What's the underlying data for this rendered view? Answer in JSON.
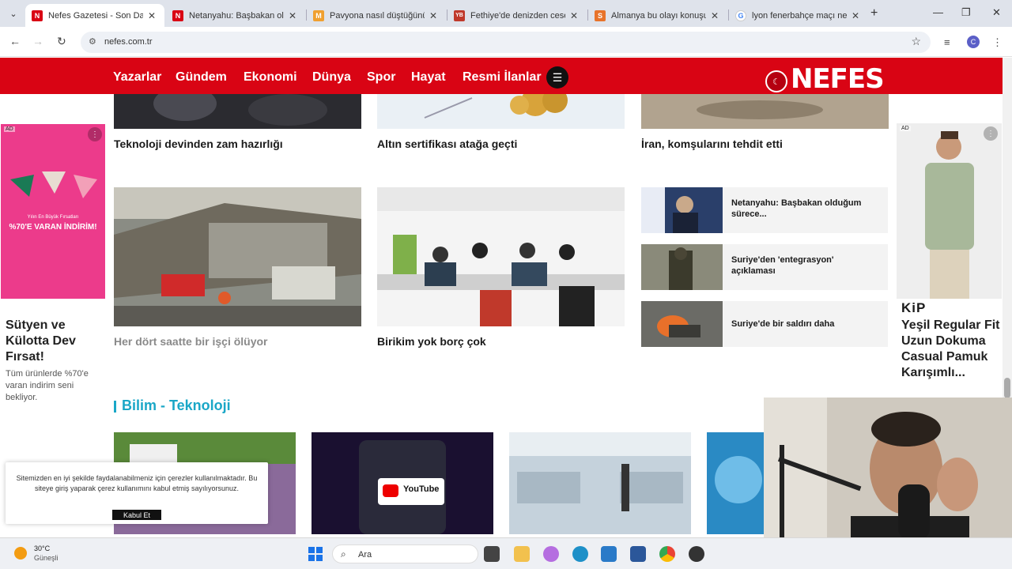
{
  "browser": {
    "tabs": [
      {
        "title": "Nefes Gazetesi - Son Dakika",
        "favicon": "N",
        "color": "#d90414",
        "active": true
      },
      {
        "title": "Netanyahu: Başbakan olduğum",
        "favicon": "N",
        "color": "#d90414",
        "active": false
      },
      {
        "title": "Pavyona nasıl düştüğünü anlattı",
        "favicon": "M",
        "color": "#f0a030",
        "active": false
      },
      {
        "title": "Fethiye'de denizden ceset çıktı",
        "favicon": "YB",
        "color": "#c0392b",
        "active": false
      },
      {
        "title": "Almanya bu olayı konuşuyor",
        "favicon": "S",
        "color": "#e8732a",
        "active": false
      },
      {
        "title": "lyon fenerbahçe maçı ne zaman",
        "favicon": "G",
        "color": "#4285f4",
        "active": false
      }
    ],
    "url": "nefes.com.tr",
    "profile_initial": "C"
  },
  "site": {
    "nav": [
      "Yazarlar",
      "Gündem",
      "Ekonomi",
      "Dünya",
      "Spor",
      "Hayat",
      "Resmi İlanlar"
    ],
    "logo": "NEFES",
    "brand_color": "#d90414"
  },
  "news": {
    "top_row": [
      "Teknoloji devinden zam hazırlığı",
      "Altın sertifikası atağa geçti",
      "İran, komşularını tehdit etti"
    ],
    "mid_row": [
      "Her dört saatte bir işçi ölüyor",
      "Birikim yok borç çok"
    ],
    "side_list": [
      "Netanyahu: Başbakan olduğum sürece...",
      "Suriye'den 'entegrasyon' açıklaması",
      "Suriye'de bir saldırı daha"
    ],
    "section_title": "Bilim - Teknoloji",
    "section_color": "#1aa7c7"
  },
  "ads": {
    "tag": "AD",
    "left_banner_line1": "Yılın En Büyük Fırsatları",
    "left_banner_line2": "%70'E VARAN İNDİRİM!",
    "left_title": "Sütyen ve Külotta Dev Fırsat!",
    "left_sub": "Tüm ürünlerde %70'e varan indirim seni bekliyor.",
    "right_brand": "KiP",
    "right_title": "Yeşil Regular Fit Uzun Dokuma Casual Pamuk Karışımlı..."
  },
  "cookie": {
    "text": "Sitemizden en iyi şekilde faydalanabilmeniz için çerezler kullanılmaktadır. Bu siteye giriş yaparak çerez kullanımını kabul etmiş sayılıyorsunuz.",
    "button": "Kabul Et"
  },
  "taskbar": {
    "temperature": "30°C",
    "weather": "Güneşli",
    "search_placeholder": "Ara"
  },
  "thumbnails": {
    "youtube_label": "YouTube"
  }
}
